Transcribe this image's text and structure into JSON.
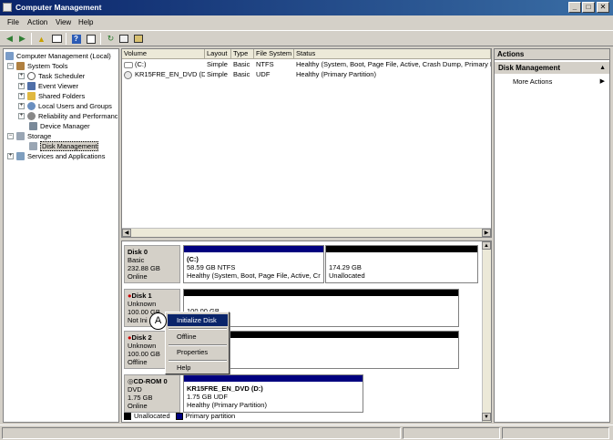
{
  "window": {
    "title": "Computer Management",
    "min": "_",
    "max": "□",
    "close": "✕"
  },
  "menu": [
    "File",
    "Action",
    "View",
    "Help"
  ],
  "toolbar_icons": [
    "back-icon",
    "forward-icon",
    "up-icon",
    "show-hide-tree-icon",
    "help-icon",
    "properties-icon",
    "refresh-icon",
    "export-icon",
    "connect-icon"
  ],
  "tree": {
    "root": "Computer Management (Local)",
    "system_tools": "System Tools",
    "task_scheduler": "Task Scheduler",
    "event_viewer": "Event Viewer",
    "shared_folders": "Shared Folders",
    "local_users": "Local Users and Groups",
    "reliability": "Reliability and Performanc",
    "device_manager": "Device Manager",
    "storage": "Storage",
    "disk_management": "Disk Management",
    "services": "Services and Applications"
  },
  "volumes": {
    "headers": [
      "Volume",
      "Layout",
      "Type",
      "File System",
      "Status"
    ],
    "rows": [
      [
        "(C:)",
        "Simple",
        "Basic",
        "NTFS",
        "Healthy (System, Boot, Page File, Active, Crash Dump, Primary Pa"
      ],
      [
        "KR15FRE_EN_DVD (D:)",
        "Simple",
        "Basic",
        "UDF",
        "Healthy (Primary Partition)"
      ]
    ]
  },
  "disks": {
    "disk0": {
      "name": "Disk 0",
      "type": "Basic",
      "size": "232.88 GB",
      "state": "Online"
    },
    "disk0_c": {
      "label": "(C:)",
      "size": "58.59 GB NTFS",
      "status": "Healthy (System, Boot, Page File, Active, Cr"
    },
    "disk0_un": {
      "size": "174.29 GB",
      "status": "Unallocated"
    },
    "disk1": {
      "name": "Disk 1",
      "type": "Unknown",
      "size": "100.00 GB",
      "state": "Not Ini"
    },
    "disk1_un": {
      "size": "100.00 GB"
    },
    "disk2": {
      "name": "Disk 2",
      "type": "Unknown",
      "size": "100.00 GB",
      "state": "Offline"
    },
    "cdrom": {
      "name": "CD-ROM 0",
      "type": "DVD",
      "size": "1.75 GB",
      "state": "Online"
    },
    "cdrom_part": {
      "label": "KR15FRE_EN_DVD  (D:)",
      "size": "1.75 GB UDF",
      "status": "Healthy (Primary Partition)"
    }
  },
  "legend": {
    "unallocated": "Unallocated",
    "primary": "Primary partition"
  },
  "colors": {
    "unallocated": "#000000",
    "primary": "#00007f",
    "highlight": "#0a246a",
    "title_start": "#0a246a",
    "title_end": "#3a6ea5"
  },
  "actions": {
    "header": "Actions",
    "section": "Disk Management",
    "more": "More Actions"
  },
  "context_menu": {
    "items": [
      "Initialize Disk",
      "Offline",
      "Properties",
      "Help"
    ]
  },
  "callout": "A"
}
